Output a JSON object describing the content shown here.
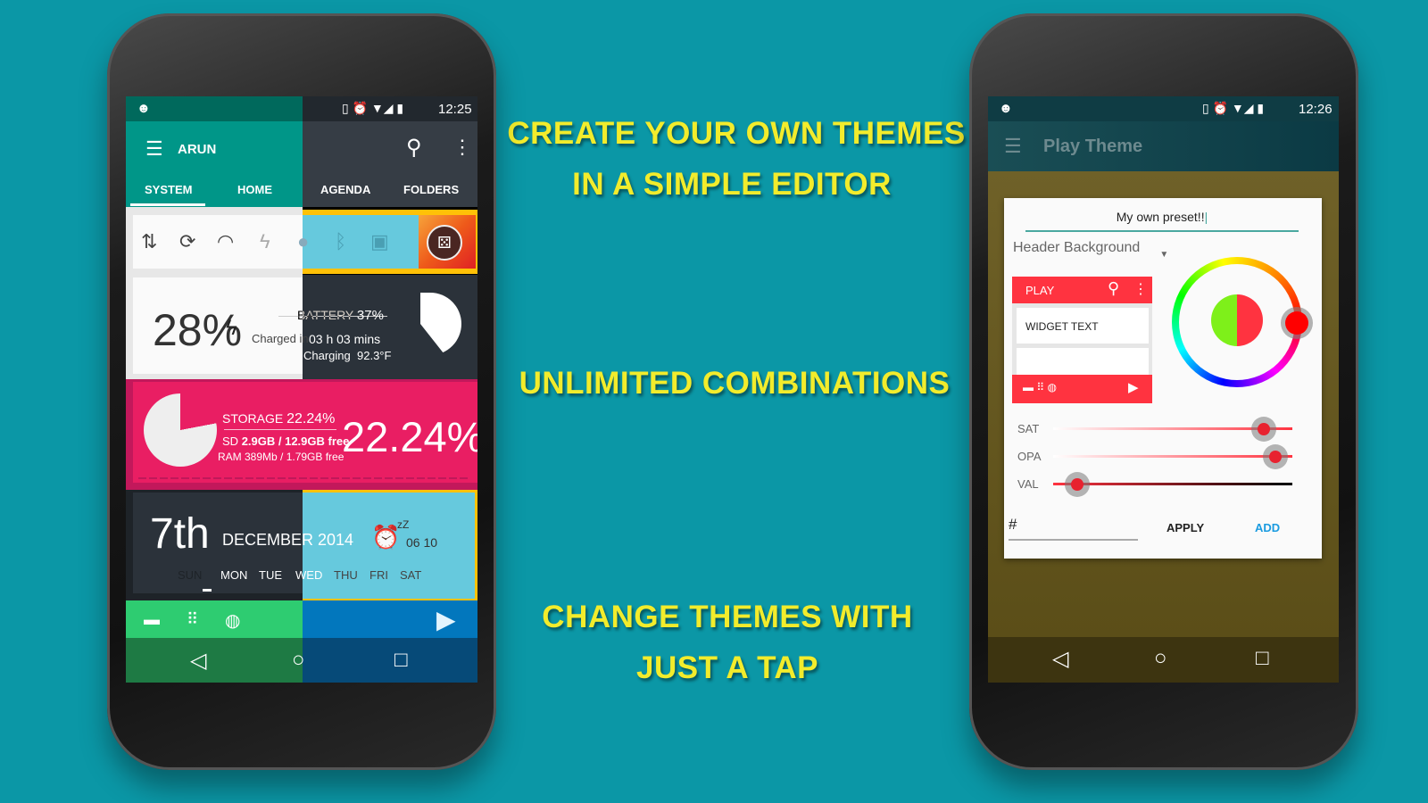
{
  "headlines": [
    "CREATE YOUR OWN THEMES",
    "IN A SIMPLE EDITOR",
    "UNLIMITED COMBINATIONS",
    "CHANGE THEMES WITH",
    "JUST A TAP"
  ],
  "left_phone": {
    "status_time": "12:25",
    "toolbar_title": "ARUN",
    "tabs": [
      "SYSTEM",
      "HOME",
      "AGENDA",
      "FOLDERS"
    ],
    "battery": {
      "percent": "28%",
      "label": "BATTERY",
      "label_pct": "37%",
      "charged_label": "Charged in",
      "charged_value": "03 h 03 mins",
      "charging": "Charging",
      "temp": "92.3°F"
    },
    "storage": {
      "label": "STORAGE",
      "pct_small": "22.24%",
      "sd_label": "SD",
      "sd_value": "2.9GB / 12.9GB free",
      "ram": "RAM 389Mb / 1.79GB free",
      "pct_big": "22.24%"
    },
    "calendar": {
      "day": "7th",
      "month_year": "DECEMBER 2014",
      "alarm": "06 10",
      "snooze": "zZ",
      "weekdays": [
        "SUN",
        "MON",
        "TUE",
        "WED",
        "THU",
        "FRI",
        "SAT"
      ]
    },
    "colors": {
      "teal": "#009688",
      "dark": "#2e353d",
      "pink": "#e91e63",
      "cyan": "#66c9dd",
      "green": "#2ecc71",
      "blue": "#0277bd",
      "amber": "#ffc107"
    }
  },
  "right_phone": {
    "status_time": "12:26",
    "toolbar_title": "Play Theme",
    "preset_name": "My own preset!!",
    "dropdown": "Header Background",
    "preview": {
      "title": "PLAY",
      "widget_text": "WIDGET TEXT"
    },
    "sliders": [
      {
        "label": "SAT",
        "value": 0.88
      },
      {
        "label": "OPA",
        "value": 0.93
      },
      {
        "label": "VAL",
        "value": 0.1
      }
    ],
    "hex_prefix": "#",
    "apply": "APPLY",
    "add": "ADD",
    "colors": {
      "accent": "#ff3340",
      "add": "#1a9be0"
    }
  }
}
